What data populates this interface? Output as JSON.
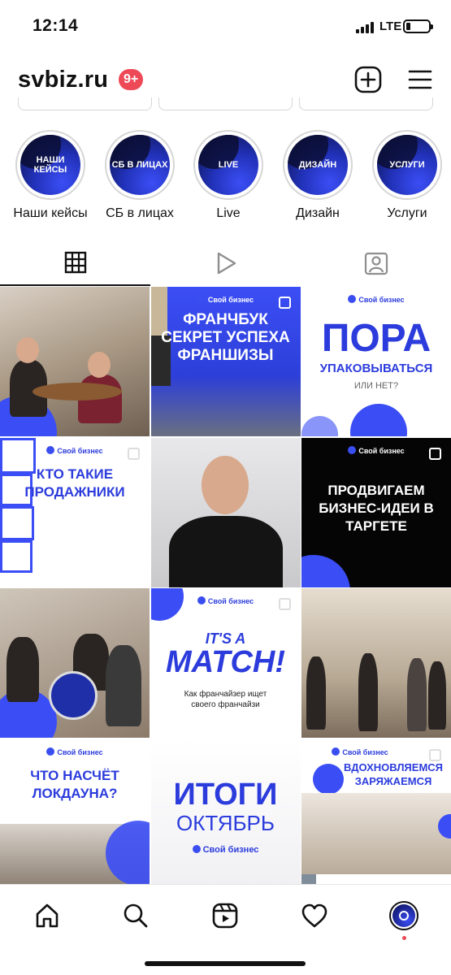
{
  "status_bar": {
    "time": "12:14",
    "network": "LTE"
  },
  "header": {
    "username": "svbiz.ru",
    "notifications_badge": "9+"
  },
  "highlights": [
    {
      "cover_text": "НАШИ КЕЙСЫ",
      "label": "Наши кейсы"
    },
    {
      "cover_text": "СБ В ЛИЦАХ",
      "label": "СБ в лицах"
    },
    {
      "cover_text": "LIVE",
      "label": "Live"
    },
    {
      "cover_text": "ДИЗАЙН",
      "label": "Дизайн"
    },
    {
      "cover_text": "УСЛУГИ",
      "label": "Услуги"
    }
  ],
  "tabs": [
    "grid-icon",
    "reels-icon",
    "tagged-icon"
  ],
  "posts": [
    {
      "kind": "photo"
    },
    {
      "brand": "Свой бизнес",
      "headline": "ФРАНЧБУК СЕКРЕТ УСПЕХА ФРАНШИЗЫ"
    },
    {
      "brand": "Свой бизнес",
      "headline": "ПОРА",
      "subheadline": "УПАКОВЫВАТЬСЯ",
      "note": "ИЛИ НЕТ?"
    },
    {
      "brand": "Свой бизнес",
      "headline": "КТО ТАКИЕ ПРОДАЖНИКИ"
    },
    {
      "kind": "photo"
    },
    {
      "brand": "Свой бизнес",
      "headline": "ПРОДВИГАЕМ БИЗНЕС-ИДЕИ В ТАРГЕТЕ"
    },
    {
      "kind": "photo"
    },
    {
      "brand": "Свой бизнес",
      "headline": "IT'S A",
      "subheadline": "MATCH!",
      "note": "Как франчайзер ищет своего франчайзи"
    },
    {
      "kind": "photo"
    },
    {
      "brand": "Свой бизнес",
      "headline": "ЧТО НАСЧЁТ ЛОКДАУНА?"
    },
    {
      "brand": "Свой бизнес",
      "headline": "ИТОГИ",
      "subheadline": "ОКТЯБРЬ"
    },
    {
      "brand": "Свой бизнес",
      "headline": "ВДОХНОВЛЯЕМСЯ ЗАРЯЖАЕМСЯ"
    }
  ],
  "bottom_nav": [
    "home-icon",
    "search-icon",
    "reels-icon",
    "heart-icon",
    "profile-avatar"
  ],
  "colors": {
    "accent": "#3b4ef5",
    "badge": "#ed4956",
    "dark": "#0b0f3a"
  }
}
